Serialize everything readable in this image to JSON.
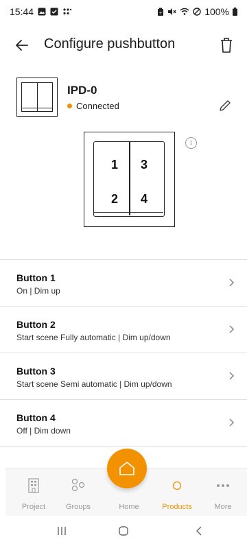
{
  "status_bar": {
    "time": "15:44",
    "battery": "100%"
  },
  "app_bar": {
    "title": "Configure pushbutton"
  },
  "device": {
    "name": "IPD-0",
    "status": "Connected",
    "status_color": "#f39200"
  },
  "switch_diagram": {
    "buttons": [
      "1",
      "3",
      "2",
      "4"
    ]
  },
  "buttons": [
    {
      "label": "Button 1",
      "function": "On | Dim up"
    },
    {
      "label": "Button 2",
      "function": "Start scene Fully automatic | Dim up/down"
    },
    {
      "label": "Button 3",
      "function": "Start scene Semi automatic | Dim up/down"
    },
    {
      "label": "Button 4",
      "function": "Off | Dim down"
    }
  ],
  "bottom_nav": {
    "items": [
      {
        "label": "Project",
        "icon": "building-icon"
      },
      {
        "label": "Groups",
        "icon": "groups-icon"
      },
      {
        "label": "Home",
        "icon": "home-icon"
      },
      {
        "label": "Products",
        "icon": "circle-icon"
      },
      {
        "label": "More",
        "icon": "more-icon"
      }
    ],
    "active": "Products",
    "accent": "#f39200"
  }
}
